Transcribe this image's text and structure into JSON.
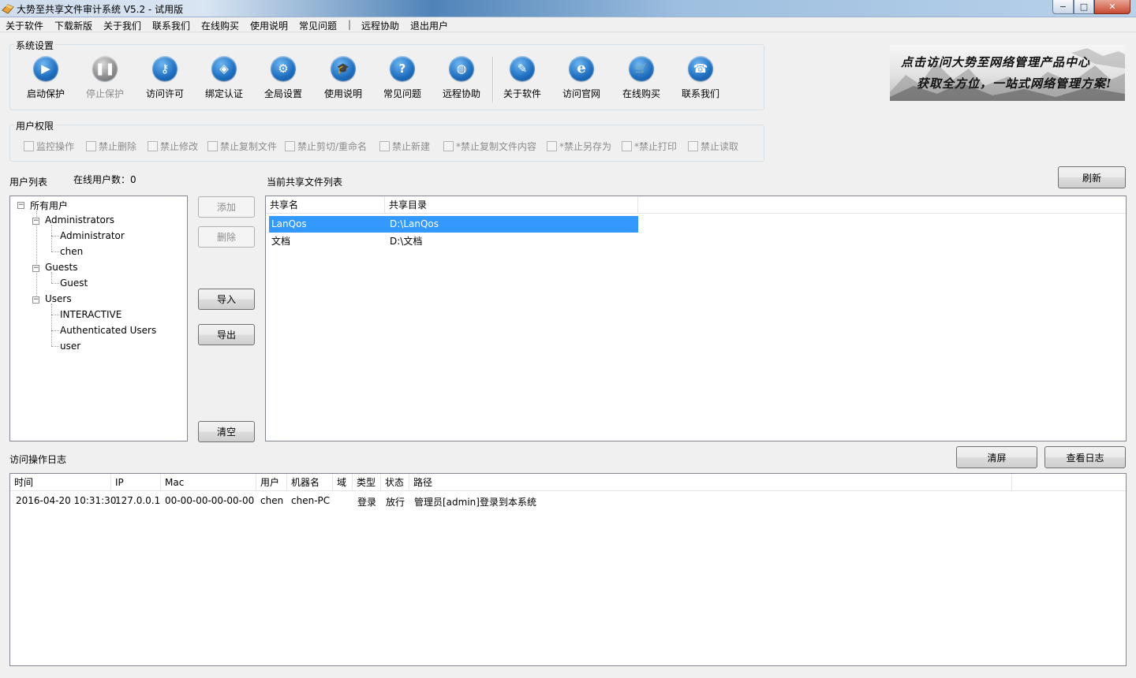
{
  "window": {
    "title": "大势至共享文件审计系统 V5.2 - 试用版",
    "min_label": "−",
    "max_label": "□",
    "close_label": "✕"
  },
  "menu": [
    "关于软件",
    "下载新版",
    "关于我们",
    "联系我们",
    "在线购买",
    "使用说明",
    "常见问题",
    "|",
    "远程协助",
    "退出用户"
  ],
  "system_settings": {
    "label": "系统设置",
    "tools": [
      {
        "label": "启动保护",
        "icon": "play-icon",
        "glyph": "▶",
        "enabled": true
      },
      {
        "label": "停止保护",
        "icon": "pause-icon",
        "glyph": "❚❚",
        "enabled": false
      },
      {
        "label": "访问许可",
        "icon": "key-icon",
        "glyph": "⚷",
        "enabled": true
      },
      {
        "label": "绑定认证",
        "icon": "shield-icon",
        "glyph": "◈",
        "enabled": true
      },
      {
        "label": "全局设置",
        "icon": "gear-icon",
        "glyph": "⚙",
        "enabled": true
      },
      {
        "label": "使用说明",
        "icon": "graduation-cap-icon",
        "glyph": "🎓",
        "enabled": true
      },
      {
        "label": "常见问题",
        "icon": "question-icon",
        "glyph": "?",
        "enabled": true
      },
      {
        "label": "远程协助",
        "icon": "globe-icon",
        "glyph": "◍",
        "enabled": true
      },
      {
        "label": "关于软件",
        "icon": "document-icon",
        "glyph": "✎",
        "enabled": true
      },
      {
        "label": "访问官网",
        "icon": "ie-browser-icon",
        "glyph": "e",
        "enabled": true
      },
      {
        "label": "在线购买",
        "icon": "shopping-cart-icon",
        "glyph": "🛒",
        "enabled": true
      },
      {
        "label": "联系我们",
        "icon": "phone-icon",
        "glyph": "☎",
        "enabled": true
      }
    ]
  },
  "banner": {
    "line1": "点击访问大势至网络管理产品中心",
    "line2": "获取全方位，一站式网络管理方案!"
  },
  "permissions": {
    "label": "用户权限",
    "items": [
      "监控操作",
      "禁止删除",
      "禁止修改",
      "禁止复制文件",
      "禁止剪切/重命名",
      "禁止新建",
      "*禁止复制文件内容",
      "*禁止另存为",
      "*禁止打印",
      "禁止读取"
    ]
  },
  "users": {
    "list_label": "用户列表",
    "online_label": "在线用户数：0",
    "tree": {
      "root": "所有用户",
      "groups": [
        {
          "name": "Administrators",
          "members": [
            "Administrator",
            "chen"
          ]
        },
        {
          "name": "Guests",
          "members": [
            "Guest"
          ]
        },
        {
          "name": "Users",
          "members": [
            "INTERACTIVE",
            "Authenticated Users",
            "user"
          ]
        }
      ]
    }
  },
  "mid_buttons": {
    "add": "添加",
    "delete": "删除",
    "import": "导入",
    "export": "导出",
    "clear": "清空"
  },
  "shares": {
    "label": "当前共享文件列表",
    "refresh": "刷新",
    "columns": [
      "共享名",
      "共享目录"
    ],
    "rows": [
      {
        "name": "LanQos",
        "path": "D:\\LanQos",
        "selected": true
      },
      {
        "name": "文档",
        "path": "D:\\文档",
        "selected": false
      }
    ]
  },
  "log": {
    "label": "访问操作日志",
    "clear_screen": "清屏",
    "view_log": "查看日志",
    "columns": [
      "时间",
      "IP",
      "Mac",
      "用户",
      "机器名",
      "域",
      "类型",
      "状态",
      "路径"
    ],
    "rows": [
      [
        "2016-04-20 10:31:30",
        "127.0.0.1",
        "00-00-00-00-00-00",
        "chen",
        "chen-PC",
        "",
        "登录",
        "放行",
        "管理员[admin]登录到本系统"
      ]
    ]
  },
  "colors": {
    "selection": "#3399ff",
    "accent": "#1f6fc0"
  }
}
